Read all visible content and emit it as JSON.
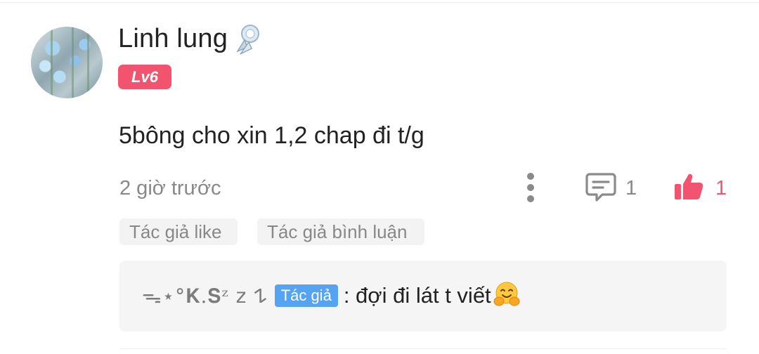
{
  "comment": {
    "username": "Linh lung",
    "name_badge_icon": "silver-badge-icon",
    "level": "Lv6",
    "text": "5bông cho xin 1,2 chap đi t/g",
    "timestamp": "2 giờ trước",
    "reply_count": "1",
    "like_count": "1"
  },
  "chips": {
    "author_like": "Tác giả like",
    "author_reply": "Tác giả bình luận"
  },
  "reply": {
    "author": "ᯓ⋆°𝐊.𝐒ᶻ 𝗓 𐰁",
    "author_tag": "Tác giả",
    "text": ": đợi đi lát t viết",
    "emoji": "hugging-face-emoji"
  },
  "colors": {
    "accent_pink": "#f2546f",
    "author_tag_blue": "#55a3f2",
    "muted_text": "#888888"
  }
}
